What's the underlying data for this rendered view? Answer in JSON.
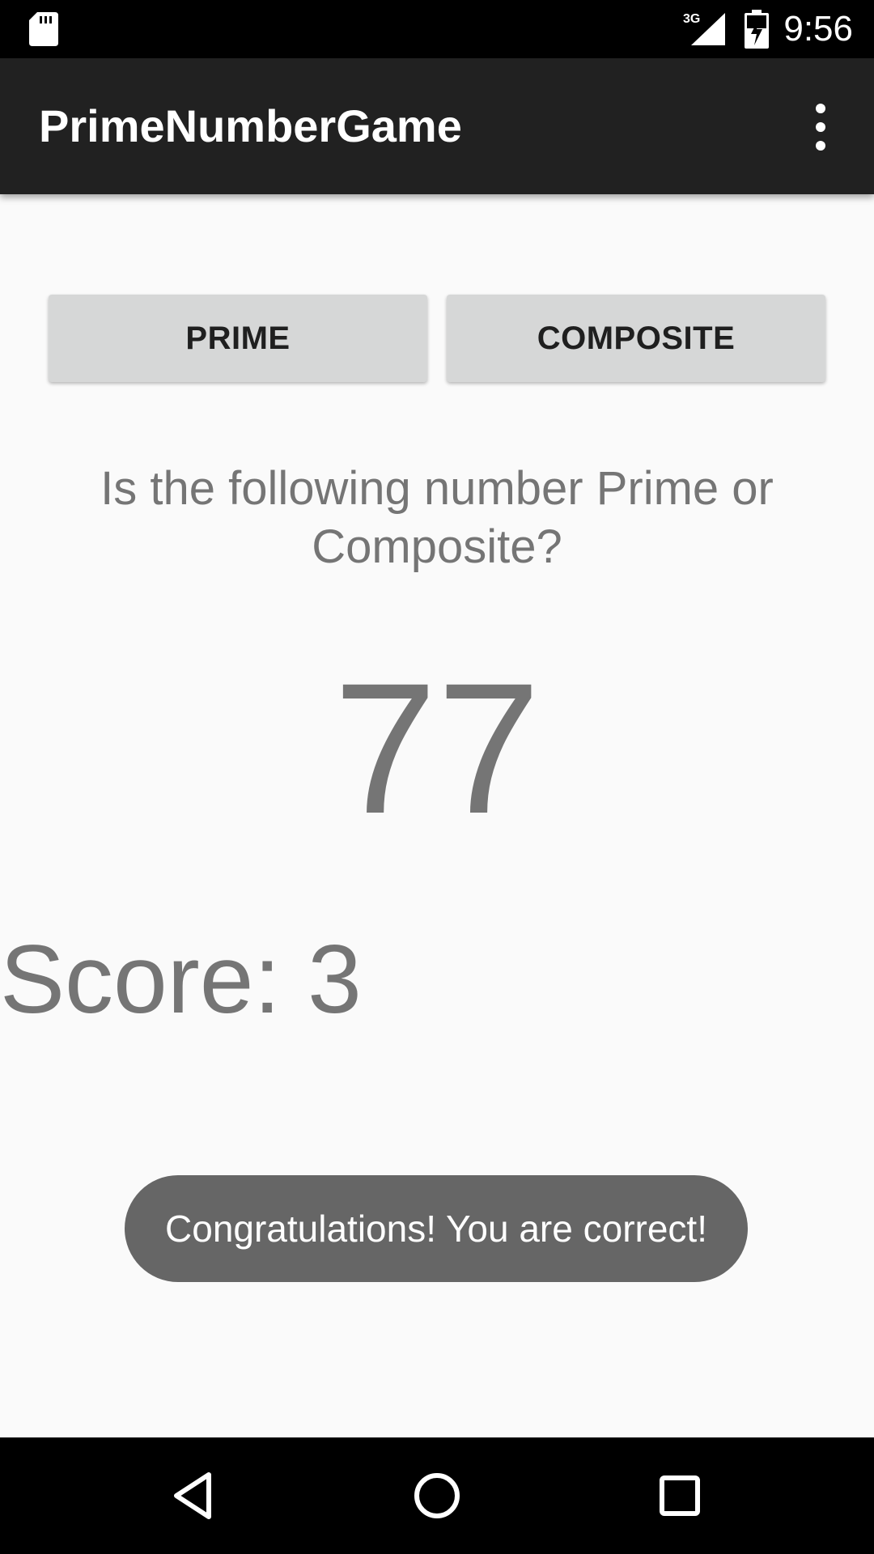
{
  "status_bar": {
    "time": "9:56",
    "network": "3G",
    "icons": [
      "sd-card-icon",
      "signal-icon",
      "battery-charging-icon"
    ]
  },
  "app_bar": {
    "title": "PrimeNumberGame",
    "menu_icon": "overflow-menu-icon"
  },
  "buttons": {
    "prime_label": "PRIME",
    "composite_label": "COMPOSITE"
  },
  "question": "Is the following number Prime or Composite?",
  "current_number": "77",
  "score_text": "Score: 3",
  "toast": "Congratulations! You are correct!",
  "nav_bar": {
    "icons": [
      "back-icon",
      "home-icon",
      "recents-icon"
    ]
  },
  "colors": {
    "app_bar": "#212121",
    "background": "#fafafa",
    "button": "#d6d7d7",
    "text_secondary": "#757575",
    "toast": "#666666"
  }
}
